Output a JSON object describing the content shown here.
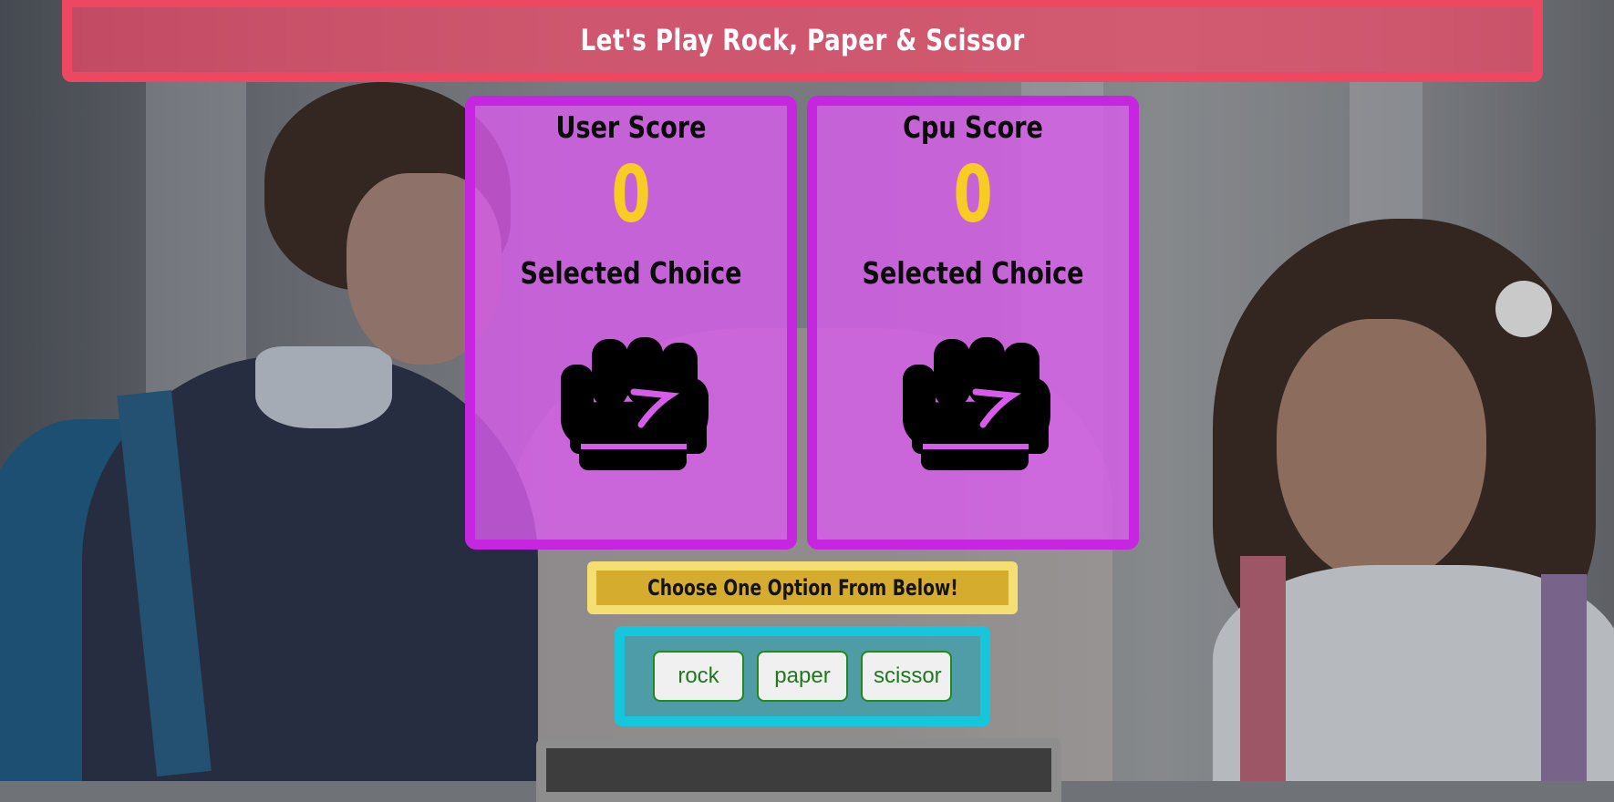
{
  "header": {
    "title": "Let's Play Rock, Paper & Scissor"
  },
  "user_card": {
    "label": "User Score",
    "score": "0",
    "choice_label": "Selected Choice",
    "choice_icon": "rock-fist-icon"
  },
  "cpu_card": {
    "label": "Cpu Score",
    "score": "0",
    "choice_label": "Selected Choice",
    "choice_icon": "rock-fist-icon"
  },
  "prompt": {
    "text": "Choose One Option From Below!"
  },
  "options": [
    {
      "label": "rock"
    },
    {
      "label": "paper"
    },
    {
      "label": "scissor"
    }
  ],
  "colors": {
    "header": "#ee4761",
    "card_border": "#c626e0",
    "score": "#f8cc22",
    "prompt_border": "#f5df73",
    "options_border": "#16c6dc",
    "button_text": "#1f7a1f"
  }
}
